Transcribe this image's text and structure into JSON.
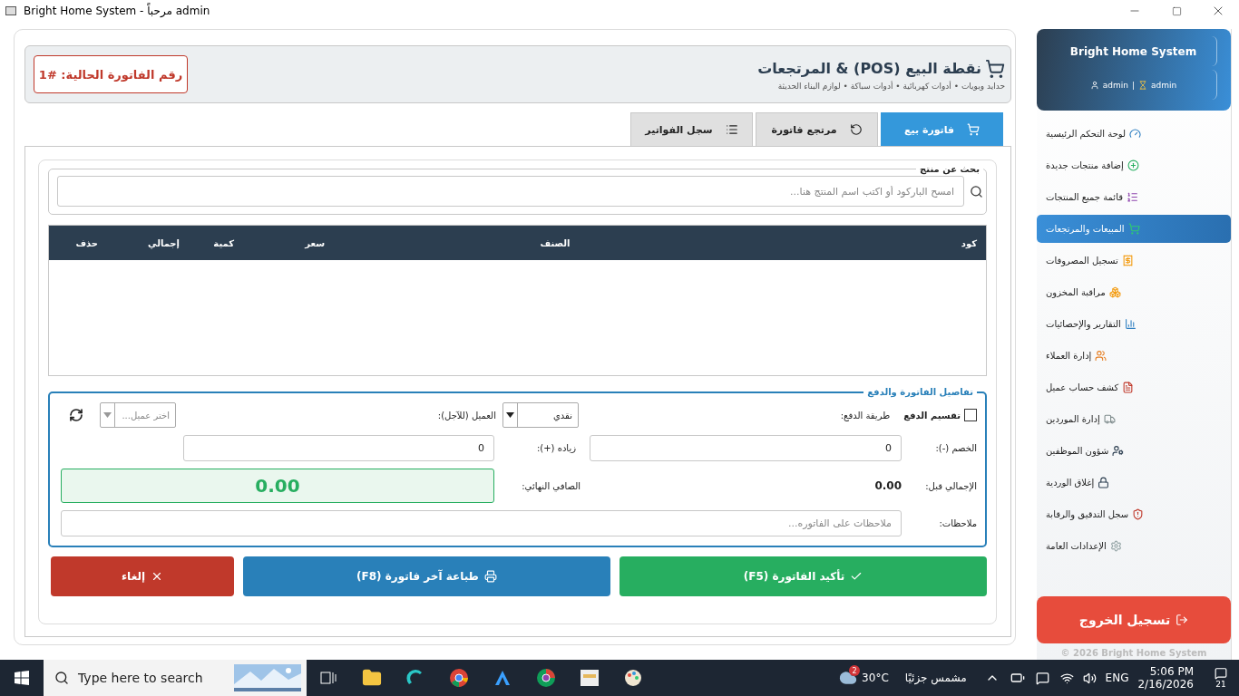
{
  "window": {
    "title": "Bright Home System - مرحباً admin"
  },
  "header": {
    "invoice_number": "رقم الفاتورة الحالية: #1",
    "title": "نقطة البيع (POS) & المرتجعات",
    "subtitle": "حدايد وبويات • أدوات كهربائية • أدوات سباكة • لوازم البناء الحديثة"
  },
  "tabs": [
    {
      "label": "فاتورة بيع",
      "selected": true
    },
    {
      "label": "مرتجع فاتورة",
      "selected": false
    },
    {
      "label": "سجل الفواتير",
      "selected": false
    }
  ],
  "search": {
    "legend": "بحث عن منتج",
    "placeholder": "امسح الباركود أو اكتب اسم المنتج هنا..."
  },
  "table": {
    "columns": [
      "كود",
      "الصنف",
      "سعر",
      "كمية",
      "إجمالي",
      "حذف"
    ]
  },
  "details": {
    "legend": "تفاصيل الفاتورة والدفع",
    "split_payment": {
      "label": "تقسيم الدفع",
      "checked": false
    },
    "payment_method_label": "طريقة الدفع:",
    "payment_method": "نقدي",
    "customer_label": "العميل (للآجل):",
    "customer_placeholder": "اختر عميل...",
    "discount_label": "الخصم (-):",
    "discount": "0",
    "addition_label": "زياده (+):",
    "addition": "0",
    "total_before_label": "الإجمالي قبل:",
    "total_before": "0.00",
    "net_label": "الصافي النهائي:",
    "net": "0.00",
    "notes_label": "ملاحظات:",
    "notes_placeholder": "ملاحظات على الفاتوره..."
  },
  "buttons": [
    {
      "label": "تأكيد الفاتورة (F5)",
      "kind": "confirm"
    },
    {
      "label": "طباعة آخر فاتورة (F8)",
      "kind": "print"
    },
    {
      "label": "إلغاء",
      "kind": "cancel"
    }
  ],
  "sidebar": {
    "app_name": "Bright Home System",
    "user": "admin",
    "separator": "|",
    "role": "admin",
    "items": [
      {
        "label": "لوحة التحكم الرئيسية",
        "selected": false
      },
      {
        "label": "إضافة منتجات جديدة",
        "selected": false
      },
      {
        "label": "قائمة جميع المنتجات",
        "selected": false
      },
      {
        "label": "المبيعات والمرتجعات",
        "selected": true
      },
      {
        "label": "تسجيل المصروفات",
        "selected": false
      },
      {
        "label": "مراقبة المخزون",
        "selected": false
      },
      {
        "label": "التقارير والإحصائيات",
        "selected": false
      },
      {
        "label": "إدارة العملاء",
        "selected": false
      },
      {
        "label": "كشف حساب عميل",
        "selected": false
      },
      {
        "label": "إدارة الموردين",
        "selected": false
      },
      {
        "label": "شؤون الموظفين",
        "selected": false
      },
      {
        "label": "إغلاق الوردية",
        "selected": false
      },
      {
        "label": "سجل التدقيق والرقابة",
        "selected": false
      },
      {
        "label": "الإعدادات العامة",
        "selected": false
      }
    ],
    "logout": "تسجيل الخروج",
    "footer": "© 2026 Bright Home System"
  },
  "taskbar": {
    "search_placeholder": "Type here to search",
    "weather_badge": "2",
    "temperature": "30°C",
    "weather_text": "مشمس جزئيًا",
    "language": "ENG",
    "time": "5:06 PM",
    "date": "2/16/2026",
    "notifications": "21"
  }
}
